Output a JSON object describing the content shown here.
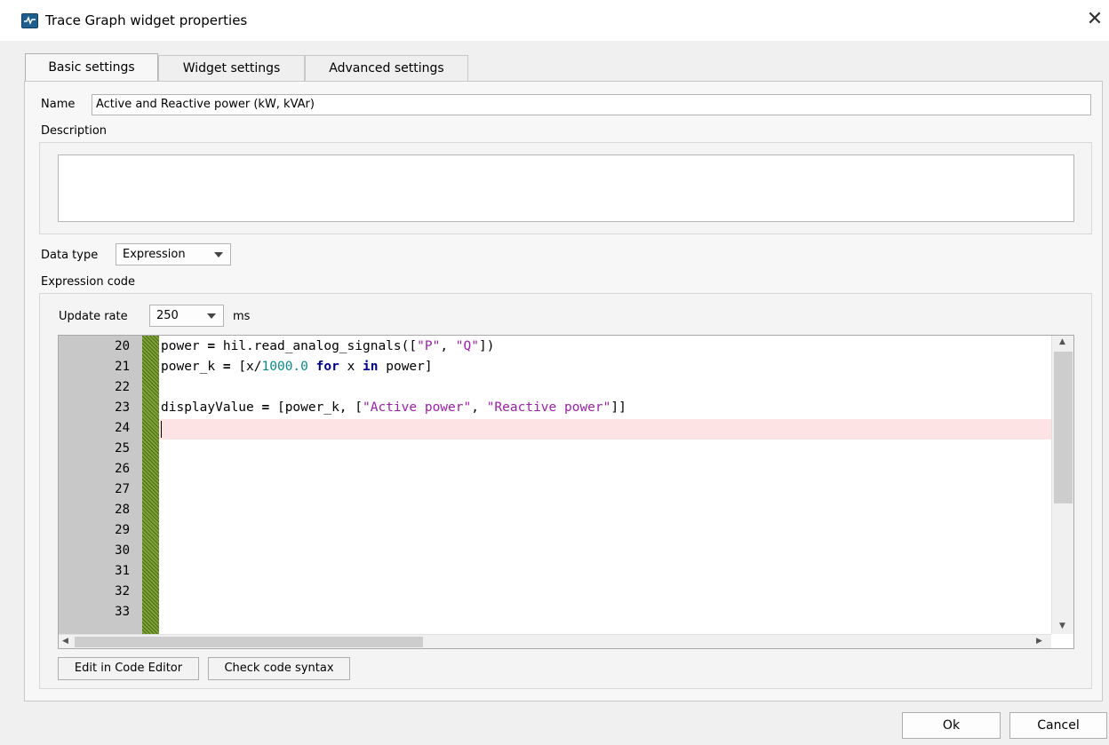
{
  "window": {
    "title": "Trace Graph widget properties",
    "close_glyph": "✕",
    "icon": "trace-graph-icon"
  },
  "tabs": [
    {
      "label": "Basic settings",
      "active": true
    },
    {
      "label": "Widget settings",
      "active": false
    },
    {
      "label": "Advanced settings",
      "active": false
    }
  ],
  "basic": {
    "name_label": "Name",
    "name_value": "Active and Reactive power (kW, kVAr)",
    "description_label": "Description",
    "description_value": "",
    "data_type_label": "Data type",
    "data_type_value": "Expression",
    "expression_code_label": "Expression code",
    "update_rate_label": "Update rate",
    "update_rate_value": "250",
    "update_rate_unit": "ms"
  },
  "editor": {
    "line_numbers": [
      "20",
      "21",
      "22",
      "23",
      "24",
      "25",
      "26",
      "27",
      "28",
      "29",
      "30",
      "31",
      "32",
      "33"
    ],
    "current_line": "24",
    "code": {
      "l20": {
        "a": "power",
        "b": " = ",
        "c": "hil.read_analog_signals([",
        "d": "\"P\"",
        "e": ", ",
        "f": "\"Q\"",
        "g": "])"
      },
      "l21": {
        "a": "power_k",
        "b": " = ",
        "c": "[x/",
        "d": "1000.0",
        "e": " ",
        "f": "for",
        "g": " x ",
        "h": "in",
        "i": " power]"
      },
      "l22": "",
      "l23": {
        "a": "displayValue",
        "b": " = ",
        "c": "[power_k, [",
        "d": "\"Active power\"",
        "e": ", ",
        "f": "\"Reactive power\"",
        "g": "]]"
      }
    },
    "syntax_colors": {
      "keyword": "#00008b",
      "number": "#0a8a8a",
      "string": "#9b1fa8",
      "current_line_bg": "#fde3e3",
      "fold_margin": "#6f8f2f"
    }
  },
  "code_buttons": {
    "edit": "Edit in Code Editor",
    "check": "Check code syntax"
  },
  "dialog_buttons": {
    "ok": "Ok",
    "cancel": "Cancel"
  }
}
